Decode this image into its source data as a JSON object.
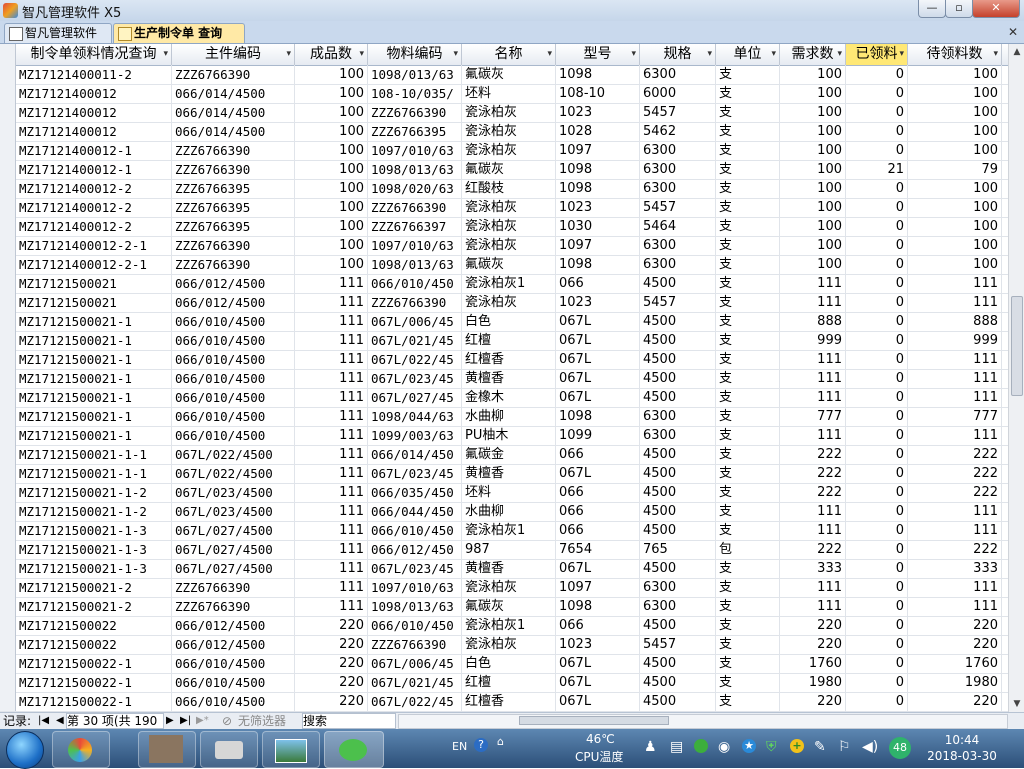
{
  "window": {
    "title": "智凡管理软件 X5",
    "min": "—",
    "max": "▫",
    "close": "✕"
  },
  "tabs": [
    {
      "label": "智凡管理软件"
    },
    {
      "label": "生产制令单 查询"
    }
  ],
  "tab_close": "✕",
  "columns": [
    "制令单领料情况查询",
    "主件编码",
    "成品数",
    "物料编码",
    "名称",
    "型号",
    "规格",
    "单位",
    "需求数",
    "已领料",
    "待领料数"
  ],
  "sort_arrow": "▾",
  "rows": [
    [
      "MZ17121400011-2",
      "ZZZ6766390",
      "100",
      "1098/013/63",
      "氟碳灰",
      "1098",
      "6300",
      "支",
      "100",
      "0",
      "100"
    ],
    [
      "MZ17121400012",
      "066/014/4500",
      "100",
      "108-10/035/",
      "坯料",
      "108-10",
      "6000",
      "支",
      "100",
      "0",
      "100"
    ],
    [
      "MZ17121400012",
      "066/014/4500",
      "100",
      "ZZZ6766390",
      "瓷泳柏灰",
      "1023",
      "5457",
      "支",
      "100",
      "0",
      "100"
    ],
    [
      "MZ17121400012",
      "066/014/4500",
      "100",
      "ZZZ6766395",
      "瓷泳柏灰",
      "1028",
      "5462",
      "支",
      "100",
      "0",
      "100"
    ],
    [
      "MZ17121400012-1",
      "ZZZ6766390",
      "100",
      "1097/010/63",
      "瓷泳柏灰",
      "1097",
      "6300",
      "支",
      "100",
      "0",
      "100"
    ],
    [
      "MZ17121400012-1",
      "ZZZ6766390",
      "100",
      "1098/013/63",
      "氟碳灰",
      "1098",
      "6300",
      "支",
      "100",
      "21",
      "79"
    ],
    [
      "MZ17121400012-2",
      "ZZZ6766395",
      "100",
      "1098/020/63",
      "红酸枝",
      "1098",
      "6300",
      "支",
      "100",
      "0",
      "100"
    ],
    [
      "MZ17121400012-2",
      "ZZZ6766395",
      "100",
      "ZZZ6766390",
      "瓷泳柏灰",
      "1023",
      "5457",
      "支",
      "100",
      "0",
      "100"
    ],
    [
      "MZ17121400012-2",
      "ZZZ6766395",
      "100",
      "ZZZ6766397",
      "瓷泳柏灰",
      "1030",
      "5464",
      "支",
      "100",
      "0",
      "100"
    ],
    [
      "MZ17121400012-2-1",
      "ZZZ6766390",
      "100",
      "1097/010/63",
      "瓷泳柏灰",
      "1097",
      "6300",
      "支",
      "100",
      "0",
      "100"
    ],
    [
      "MZ17121400012-2-1",
      "ZZZ6766390",
      "100",
      "1098/013/63",
      "氟碳灰",
      "1098",
      "6300",
      "支",
      "100",
      "0",
      "100"
    ],
    [
      "MZ17121500021",
      "066/012/4500",
      "111",
      "066/010/450",
      "瓷泳柏灰1",
      "066",
      "4500",
      "支",
      "111",
      "0",
      "111"
    ],
    [
      "MZ17121500021",
      "066/012/4500",
      "111",
      "ZZZ6766390",
      "瓷泳柏灰",
      "1023",
      "5457",
      "支",
      "111",
      "0",
      "111"
    ],
    [
      "MZ17121500021-1",
      "066/010/4500",
      "111",
      "067L/006/45",
      "白色",
      "067L",
      "4500",
      "支",
      "888",
      "0",
      "888"
    ],
    [
      "MZ17121500021-1",
      "066/010/4500",
      "111",
      "067L/021/45",
      "红檀",
      "067L",
      "4500",
      "支",
      "999",
      "0",
      "999"
    ],
    [
      "MZ17121500021-1",
      "066/010/4500",
      "111",
      "067L/022/45",
      "红檀香",
      "067L",
      "4500",
      "支",
      "111",
      "0",
      "111"
    ],
    [
      "MZ17121500021-1",
      "066/010/4500",
      "111",
      "067L/023/45",
      "黄檀香",
      "067L",
      "4500",
      "支",
      "111",
      "0",
      "111"
    ],
    [
      "MZ17121500021-1",
      "066/010/4500",
      "111",
      "067L/027/45",
      "金橡木",
      "067L",
      "4500",
      "支",
      "111",
      "0",
      "111"
    ],
    [
      "MZ17121500021-1",
      "066/010/4500",
      "111",
      "1098/044/63",
      "水曲柳",
      "1098",
      "6300",
      "支",
      "777",
      "0",
      "777"
    ],
    [
      "MZ17121500021-1",
      "066/010/4500",
      "111",
      "1099/003/63",
      "PU柚木",
      "1099",
      "6300",
      "支",
      "111",
      "0",
      "111"
    ],
    [
      "MZ17121500021-1-1",
      "067L/022/4500",
      "111",
      "066/014/450",
      "氟碳金",
      "066",
      "4500",
      "支",
      "222",
      "0",
      "222"
    ],
    [
      "MZ17121500021-1-1",
      "067L/022/4500",
      "111",
      "067L/023/45",
      "黄檀香",
      "067L",
      "4500",
      "支",
      "222",
      "0",
      "222"
    ],
    [
      "MZ17121500021-1-2",
      "067L/023/4500",
      "111",
      "066/035/450",
      "坯料",
      "066",
      "4500",
      "支",
      "222",
      "0",
      "222"
    ],
    [
      "MZ17121500021-1-2",
      "067L/023/4500",
      "111",
      "066/044/450",
      "水曲柳",
      "066",
      "4500",
      "支",
      "111",
      "0",
      "111"
    ],
    [
      "MZ17121500021-1-3",
      "067L/027/4500",
      "111",
      "066/010/450",
      "瓷泳柏灰1",
      "066",
      "4500",
      "支",
      "111",
      "0",
      "111"
    ],
    [
      "MZ17121500021-1-3",
      "067L/027/4500",
      "111",
      "066/012/450",
      "987",
      "7654",
      "765",
      "包",
      "222",
      "0",
      "222"
    ],
    [
      "MZ17121500021-1-3",
      "067L/027/4500",
      "111",
      "067L/023/45",
      "黄檀香",
      "067L",
      "4500",
      "支",
      "333",
      "0",
      "333"
    ],
    [
      "MZ17121500021-2",
      "ZZZ6766390",
      "111",
      "1097/010/63",
      "瓷泳柏灰",
      "1097",
      "6300",
      "支",
      "111",
      "0",
      "111"
    ],
    [
      "MZ17121500021-2",
      "ZZZ6766390",
      "111",
      "1098/013/63",
      "氟碳灰",
      "1098",
      "6300",
      "支",
      "111",
      "0",
      "111"
    ],
    [
      "MZ17121500022",
      "066/012/4500",
      "220",
      "066/010/450",
      "瓷泳柏灰1",
      "066",
      "4500",
      "支",
      "220",
      "0",
      "220"
    ],
    [
      "MZ17121500022",
      "066/012/4500",
      "220",
      "ZZZ6766390",
      "瓷泳柏灰",
      "1023",
      "5457",
      "支",
      "220",
      "0",
      "220"
    ],
    [
      "MZ17121500022-1",
      "066/010/4500",
      "220",
      "067L/006/45",
      "白色",
      "067L",
      "4500",
      "支",
      "1760",
      "0",
      "1760"
    ],
    [
      "MZ17121500022-1",
      "066/010/4500",
      "220",
      "067L/021/45",
      "红檀",
      "067L",
      "4500",
      "支",
      "1980",
      "0",
      "1980"
    ],
    [
      "MZ17121500022-1",
      "066/010/4500",
      "220",
      "067L/022/45",
      "红檀香",
      "067L",
      "4500",
      "支",
      "220",
      "0",
      "220"
    ]
  ],
  "navigator": {
    "record_label": "记录:",
    "first": "|◀",
    "prev": "◀",
    "position": "第 30 项(共 190",
    "next": "▶",
    "last": "▶|",
    "new": "▶*",
    "filter": "无筛选器",
    "search": "搜索"
  },
  "taskbar": {
    "temperature": "46℃",
    "temp_label": "CPU温度",
    "lang": "EN",
    "notify_count": "48",
    "time": "10:44",
    "date": "2018-03-30"
  },
  "colors": {
    "highlight_header": "#ffe875",
    "tab_active": "#ffe9a6",
    "taskbar": "#2c4f78"
  }
}
